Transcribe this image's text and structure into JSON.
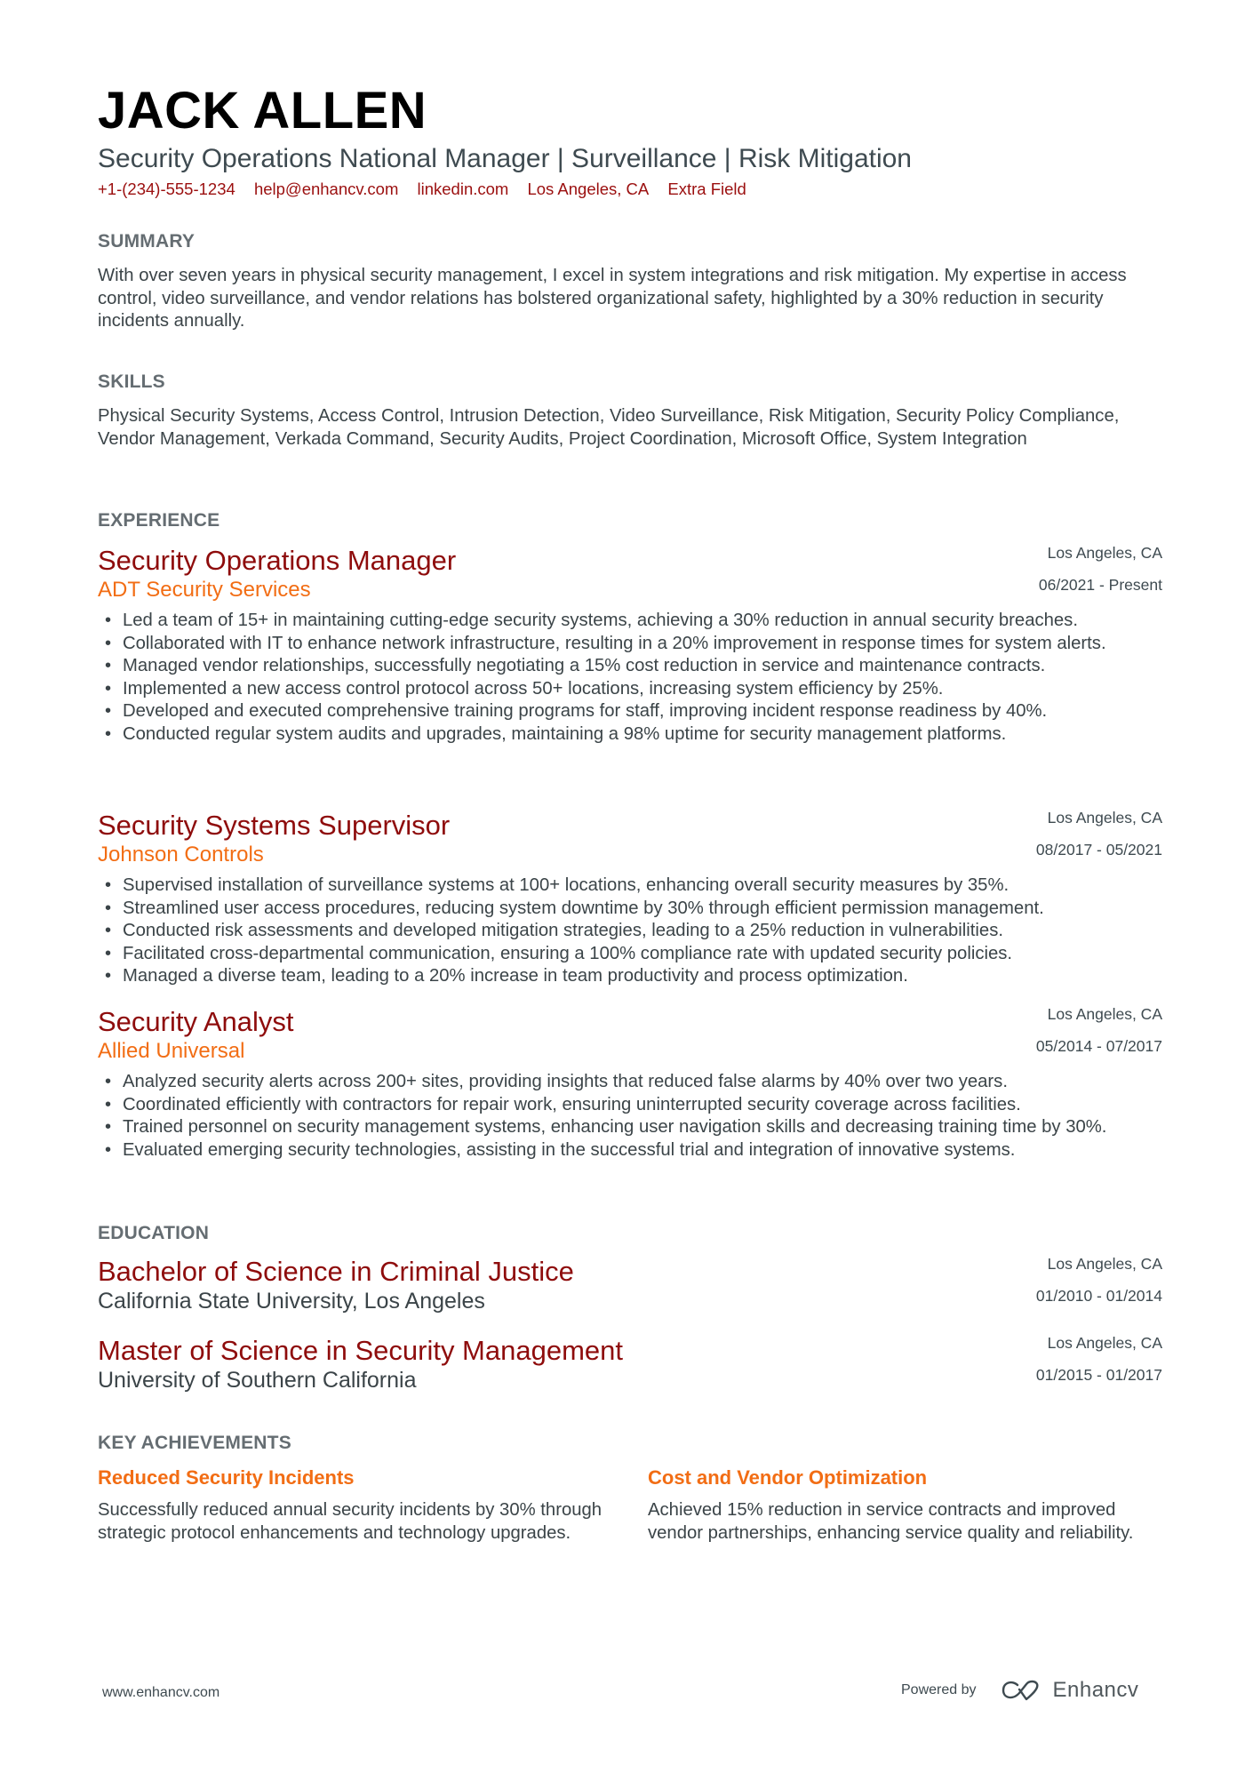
{
  "header": {
    "name": "JACK ALLEN",
    "subtitle": "Security Operations National Manager | Surveillance | Risk Mitigation",
    "contacts": [
      "+1-(234)-555-1234",
      "help@enhancv.com",
      "linkedin.com",
      "Los Angeles, CA",
      "Extra Field"
    ]
  },
  "summary": {
    "title": "SUMMARY",
    "text": "With over seven years in physical security management, I excel in system integrations and risk mitigation. My expertise in access control, video surveillance, and vendor relations has bolstered organizational safety, highlighted by a 30% reduction in security incidents annually."
  },
  "skills": {
    "title": "SKILLS",
    "text": "Physical Security Systems, Access Control, Intrusion Detection, Video Surveillance, Risk Mitigation, Security Policy Compliance, Vendor Management, Verkada Command, Security Audits, Project Coordination, Microsoft Office, System Integration"
  },
  "experience": {
    "title": "EXPERIENCE",
    "items": [
      {
        "role": "Security Operations Manager",
        "company": "ADT Security Services",
        "location": "Los Angeles, CA",
        "dates": "06/2021 - Present",
        "bullets": [
          "Led a team of 15+ in maintaining cutting-edge security systems, achieving a 30% reduction in annual security breaches.",
          "Collaborated with IT to enhance network infrastructure, resulting in a 20% improvement in response times for system alerts.",
          "Managed vendor relationships, successfully negotiating a 15% cost reduction in service and maintenance contracts.",
          "Implemented a new access control protocol across 50+ locations, increasing system efficiency by 25%.",
          "Developed and executed comprehensive training programs for staff, improving incident response readiness by 40%.",
          "Conducted regular system audits and upgrades, maintaining a 98% uptime for security management platforms."
        ]
      },
      {
        "role": "Security Systems Supervisor",
        "company": "Johnson Controls",
        "location": "Los Angeles, CA",
        "dates": "08/2017 - 05/2021",
        "bullets": [
          "Supervised installation of surveillance systems at 100+ locations, enhancing overall security measures by 35%.",
          "Streamlined user access procedures, reducing system downtime by 30% through efficient permission management.",
          "Conducted risk assessments and developed mitigation strategies, leading to a 25% reduction in vulnerabilities.",
          "Facilitated cross-departmental communication, ensuring a 100% compliance rate with updated security policies.",
          "Managed a diverse team, leading to a 20% increase in team productivity and process optimization."
        ]
      },
      {
        "role": "Security Analyst",
        "company": "Allied Universal",
        "location": "Los Angeles, CA",
        "dates": "05/2014 - 07/2017",
        "bullets": [
          "Analyzed security alerts across 200+ sites, providing insights that reduced false alarms by 40% over two years.",
          "Coordinated efficiently with contractors for repair work, ensuring uninterrupted security coverage across facilities.",
          "Trained personnel on security management systems, enhancing user navigation skills and decreasing training time by 30%.",
          "Evaluated emerging security technologies, assisting in the successful trial and integration of innovative systems."
        ]
      }
    ]
  },
  "education": {
    "title": "EDUCATION",
    "items": [
      {
        "degree": "Bachelor of Science in Criminal Justice",
        "school": "California State University, Los Angeles",
        "location": "Los Angeles, CA",
        "dates": "01/2010 - 01/2014"
      },
      {
        "degree": "Master of Science in Security Management",
        "school": "University of Southern California",
        "location": "Los Angeles, CA",
        "dates": "01/2015 - 01/2017"
      }
    ]
  },
  "achievements": {
    "title": "KEY ACHIEVEMENTS",
    "items": [
      {
        "title": "Reduced Security Incidents",
        "description": "Successfully reduced annual security incidents by 30% through strategic protocol enhancements and technology upgrades."
      },
      {
        "title": "Cost and Vendor Optimization",
        "description": "Achieved 15% reduction in service contracts and improved vendor partnerships, enhancing service quality and reliability."
      }
    ]
  },
  "footer": {
    "website": "www.enhancv.com",
    "powered_by": "Powered by",
    "brand": "Enhancv",
    "logo_icon": "enhancv-logo-icon"
  },
  "colors": {
    "name": "#000000",
    "accent_red": "#8e0c0c",
    "accent_orange": "#f26d14",
    "section_title": "#656d72",
    "body_text": "#3b4448"
  }
}
